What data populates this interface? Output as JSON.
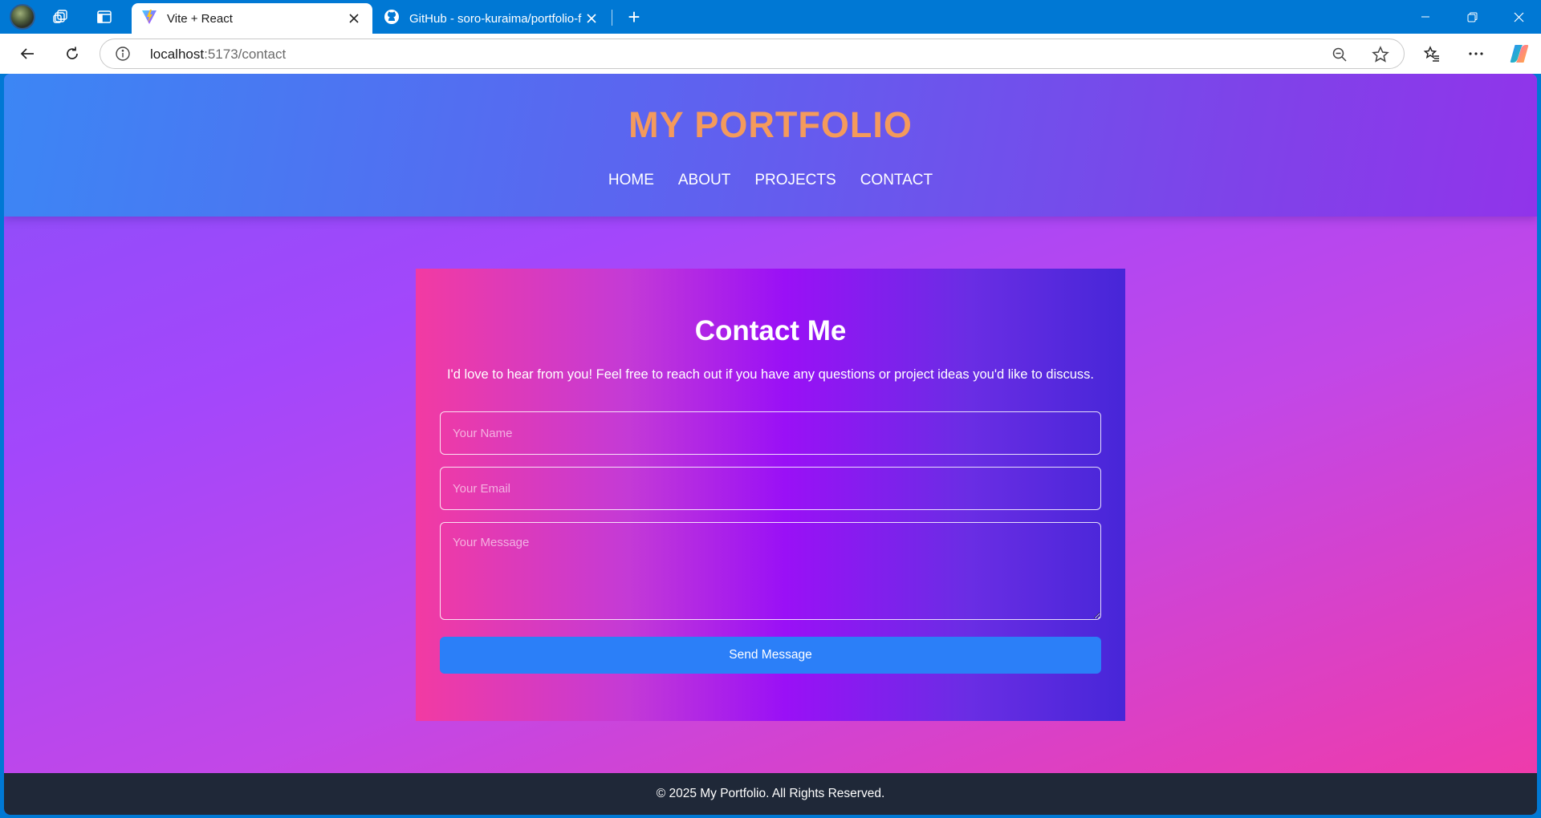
{
  "browser": {
    "tabs": [
      {
        "title": "Vite + React",
        "active": true
      },
      {
        "title": "GitHub - soro-kuraima/portfolio-f",
        "active": false
      }
    ],
    "new_tab_glyph": "+",
    "address": {
      "host": "localhost",
      "path": ":5173/contact"
    },
    "icons": [
      "profile-avatar",
      "workspaces-icon",
      "vertical-tabs-icon",
      "vite-favicon",
      "github-favicon",
      "back-icon",
      "refresh-icon",
      "site-info-icon",
      "zoom-out-icon",
      "favorite-star-icon",
      "favorites-icon",
      "more-icon",
      "copilot-icon",
      "minimize-icon",
      "restore-icon",
      "close-window-icon"
    ]
  },
  "site": {
    "logo": "MY PORTFOLIO",
    "nav": [
      "HOME",
      "ABOUT",
      "PROJECTS",
      "CONTACT"
    ],
    "contact": {
      "title": "Contact Me",
      "intro": "I'd love to hear from you! Feel free to reach out if you have any questions or project ideas you'd like to discuss.",
      "name_placeholder": "Your Name",
      "email_placeholder": "Your Email",
      "message_placeholder": "Your Message",
      "submit_label": "Send Message"
    },
    "footer": "© 2025 My Portfolio. All Rights Reserved."
  },
  "colors": {
    "browser_accent": "#0078d4",
    "logo": "#f49a5c",
    "button": "#2b7ff8",
    "footer_bg": "#1f2838"
  }
}
